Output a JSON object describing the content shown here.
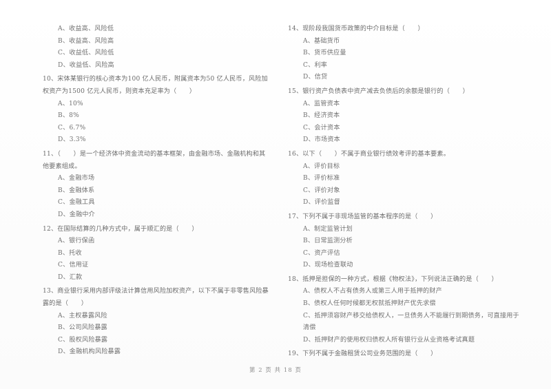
{
  "document": {
    "type": "scanned-exam-paper",
    "footer": "第 2 页 共 18 页"
  },
  "left_column": {
    "orphan_options": [
      "A、收益高、风险低",
      "B、收益高、风险高",
      "C、收益低、风险低",
      "D、收益低、风险高"
    ],
    "questions": [
      {
        "stem": "10、宋体某银行的核心资本为100 亿人民币，附属资本为50 亿人民币，风险加权资产为1500 亿元人民币，则资本充足率为（　　）",
        "options": [
          "A、10%",
          "B、8%",
          "C、6.7%",
          "D、3.3%"
        ]
      },
      {
        "stem": "11、（　　）是一个经济体中资金流动的基本框架，由金融市场、金融机构和其他要素组成。",
        "options": [
          "A、金融市场",
          "B、金融体系",
          "C、金融工具",
          "D、金融中介"
        ]
      },
      {
        "stem": "12、在国际结算的几种方式中，属于顺汇的是（　　）",
        "options": [
          "A、银行保函",
          "B、托收",
          "C、信用证",
          "D、汇款"
        ]
      },
      {
        "stem": "13、商业银行采用内部评级法计算信用风险加权资产，以下不属于非零售风险暴露的是（　　）",
        "options": [
          "A、主权暴露风险",
          "B、公司风险暴露",
          "C、股权风险暴露",
          "D、金融机构风险暴露"
        ]
      }
    ]
  },
  "right_column": {
    "questions": [
      {
        "stem": "14、现阶段我国货币政策的中介目标是（　　）",
        "options": [
          "A、基础货币",
          "B、货币供应量",
          "C、利率",
          "D、信贷"
        ]
      },
      {
        "stem": "15、银行资产负债表中资产减去负债后的余额是银行的（　　）",
        "options": [
          "A、监管资本",
          "B、经济资本",
          "C、会计资本",
          "D、市场资本"
        ]
      },
      {
        "stem": "16、以下（　　）不属于商业银行绩效考评的基本要素。",
        "options": [
          "A、评价目标",
          "B、评价标准",
          "C、评价对象",
          "D、评价监督"
        ]
      },
      {
        "stem": "17、下列不属于非现场监管的基本程序的是（　　）",
        "options": [
          "A、制定监管计划",
          "B、日常监测分析",
          "C、资产评估",
          "D、现场检查联动"
        ]
      },
      {
        "stem": "18、抵押是担保的一种方式，根据《物权法》，下列说法正确的是（　　）",
        "options": [
          "A、债权人不占有债务人或第三人用于抵押的财产",
          "B、债权人任何时候都无权就抵押财产优先求偿",
          "C、抵押须容财产移交给债权人，一旦债务人不能履行到期债务，可直接用于清偿",
          "D、抵押财产的使用权归债权人所有银行业从业资格考试真题"
        ]
      },
      {
        "stem": "19、下列不属于金融租赁公司业务范围的是（　　）",
        "options": []
      }
    ]
  }
}
